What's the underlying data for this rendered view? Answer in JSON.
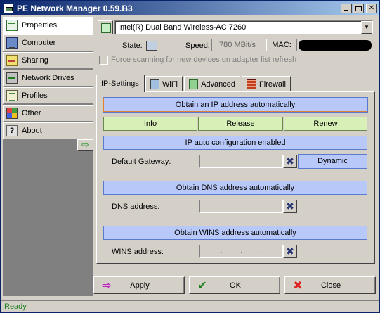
{
  "window": {
    "title": "PE Network Manager 0.59.B3"
  },
  "sidebar": {
    "items": [
      {
        "label": "Properties",
        "icon": "properties-icon"
      },
      {
        "label": "Computer",
        "icon": "computer-icon"
      },
      {
        "label": "Sharing",
        "icon": "sharing-icon"
      },
      {
        "label": "Network Drives",
        "icon": "network-drives-icon"
      },
      {
        "label": "Profiles",
        "icon": "profiles-icon"
      },
      {
        "label": "Other",
        "icon": "other-icon"
      },
      {
        "label": "About",
        "icon": "about-icon"
      }
    ],
    "active": "Properties"
  },
  "adapter": {
    "selected": "Intel(R) Dual Band Wireless-AC 7260",
    "state_label": "State:",
    "speed_label": "Speed:",
    "speed_value": "780 MBit/s",
    "mac_label": "MAC:",
    "force_scan_label": "Force scanning for new devices on adapter list refresh"
  },
  "tabs": [
    {
      "label": "IP-Settings",
      "active": true
    },
    {
      "label": "WiFi",
      "active": false
    },
    {
      "label": "Advanced",
      "active": false
    },
    {
      "label": "Firewall",
      "active": false
    }
  ],
  "ip_settings": {
    "obtain_ip": "Obtain an IP address automatically",
    "info": "Info",
    "release": "Release",
    "renew": "Renew",
    "auto_config": "IP auto configuration enabled",
    "gateway_label": "Default Gateway:",
    "dynamic": "Dynamic",
    "obtain_dns": "Obtain DNS address automatically",
    "dns_label": "DNS address:",
    "obtain_wins": "Obtain WINS address automatically",
    "wins_label": "WINS address:",
    "ip_placeholder_dots": "."
  },
  "actions": {
    "apply": "Apply",
    "ok": "OK",
    "close": "Close"
  },
  "status": {
    "text": "Ready"
  },
  "colors": {
    "titlebar": "#0a246a",
    "bar": "#b8c8f8",
    "green_button": "#d8f0b8",
    "status": "#208020"
  }
}
